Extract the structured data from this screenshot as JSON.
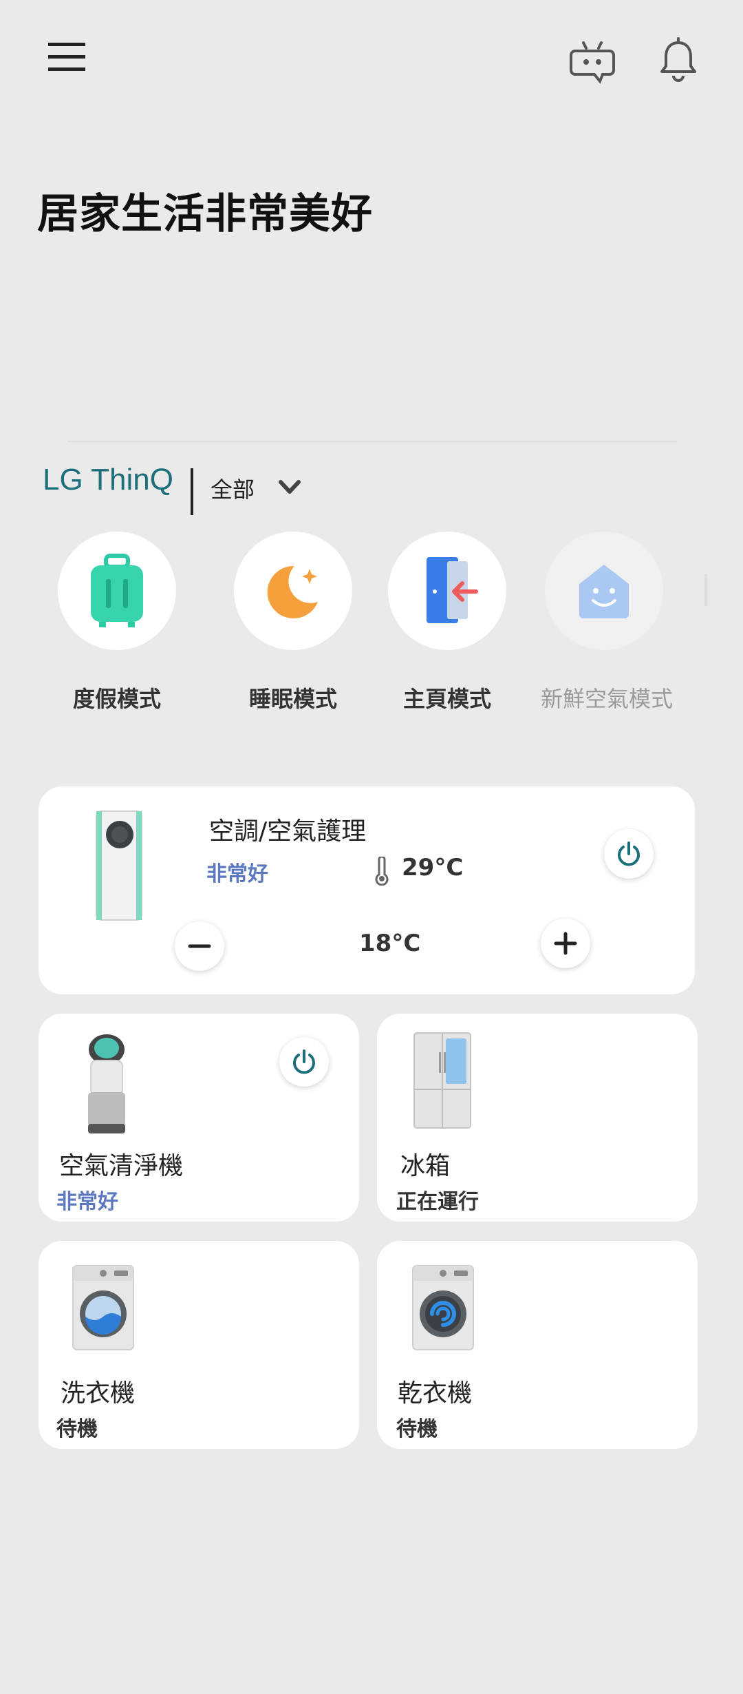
{
  "header": {
    "menu_icon": "hamburger-icon",
    "robot_icon": "chatbot-icon",
    "bell_icon": "bell-icon"
  },
  "greeting": "居家生活非常美好",
  "brand": {
    "name": "LG ThinQ",
    "filter": "全部"
  },
  "modes": [
    {
      "label": "度假模式",
      "icon": "suitcase-icon"
    },
    {
      "label": "睡眠模式",
      "icon": "moon-icon"
    },
    {
      "label": "主頁模式",
      "icon": "door-icon"
    },
    {
      "label": "新鮮空氣模式",
      "icon": "smile-house-icon"
    }
  ],
  "ac_card": {
    "title": "空調/空氣護理",
    "status": "非常好",
    "current_temp": "29°C",
    "set_temp": "18°C"
  },
  "devices": [
    {
      "title": "空氣清淨機",
      "status": "非常好"
    },
    {
      "title": "冰箱",
      "status": "正在運行"
    },
    {
      "title": "洗衣機",
      "status": "待機"
    },
    {
      "title": "乾衣機",
      "status": "待機"
    }
  ],
  "colors": {
    "accent": "#1b6f7a",
    "status_good": "#5b78c0",
    "background": "#eaeaea"
  }
}
